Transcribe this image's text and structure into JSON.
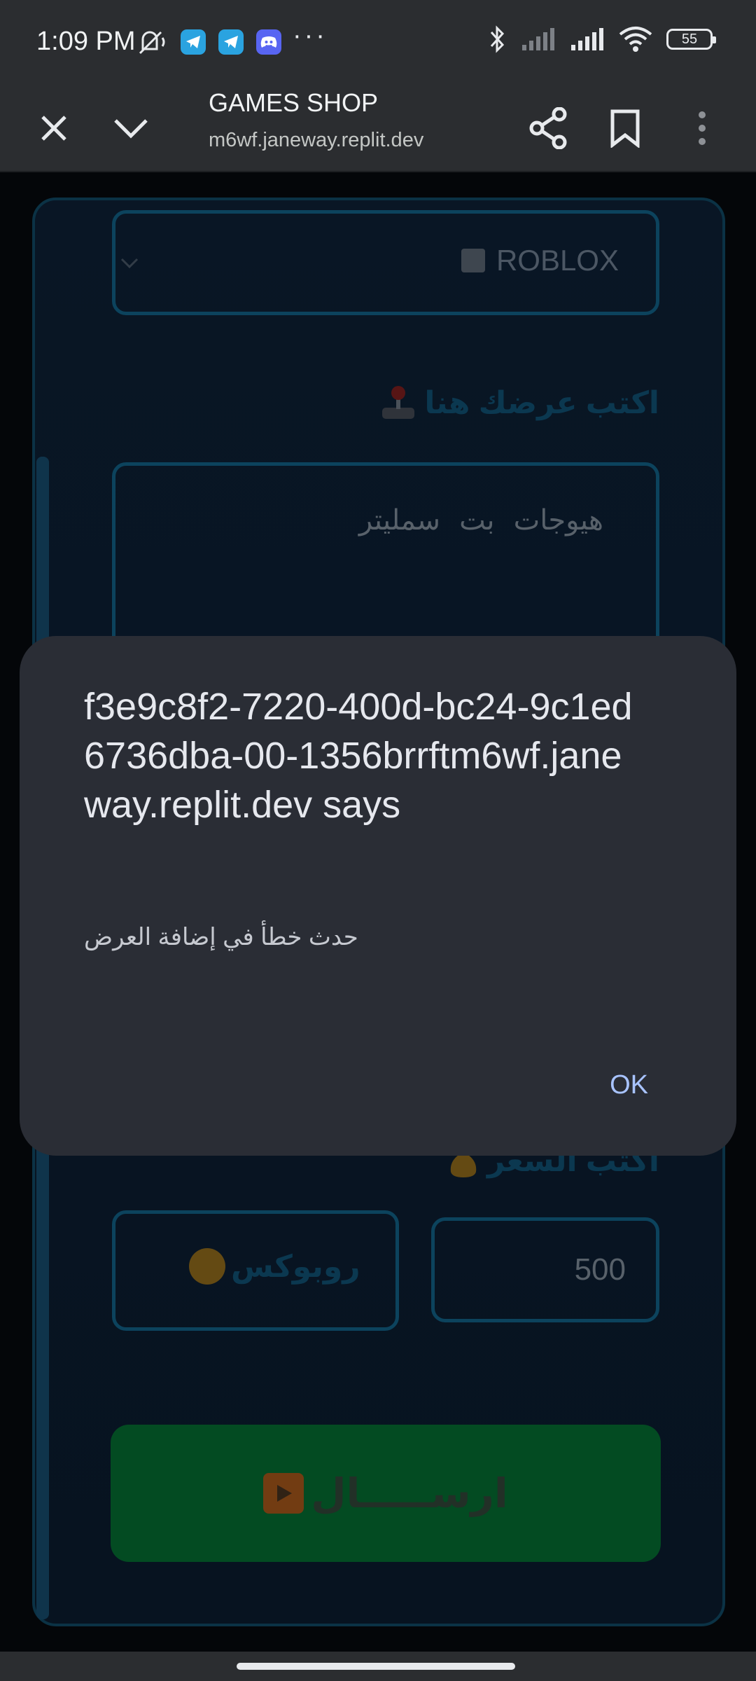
{
  "status_bar": {
    "time": "1:09 PM",
    "icons": [
      "mute-vibrate-icon",
      "telegram-icon",
      "telegram-icon",
      "discord-icon",
      "more-notifications-icon",
      "bluetooth-icon",
      "signal-icon",
      "signal-icon",
      "wifi-icon"
    ],
    "more": "···",
    "battery": "55"
  },
  "browser": {
    "title": "GAMES SHOP",
    "url": "m6wf.janeway.replit.dev"
  },
  "form": {
    "game_select": {
      "value": "ROBLOX",
      "icon": "square-icon"
    },
    "offer_label": "اكتب عرضك هنا",
    "offer_label_icon": "joystick-icon",
    "offer_text": "هيوجات بت سمليتر",
    "price_label": "اكتب السعر",
    "price_label_icon": "money-bag-icon",
    "currency": "روبوكس",
    "currency_icon": "coin-icon",
    "amount": "500",
    "submit_label": "ارســـــال",
    "submit_icon": "play-icon"
  },
  "dialog": {
    "title": "f3e9c8f2-7220-400d-bc24-9c1ed6736dba-00-1356brrftm6wf.janeway.replit.dev says",
    "message": "حدث خطأ في إضافة العرض",
    "ok_label": "OK"
  },
  "colors": {
    "accent": "#0f5272",
    "submit": "#045c2a",
    "dialog_bg": "#2a2d35",
    "ok": "#a8c3ff"
  }
}
